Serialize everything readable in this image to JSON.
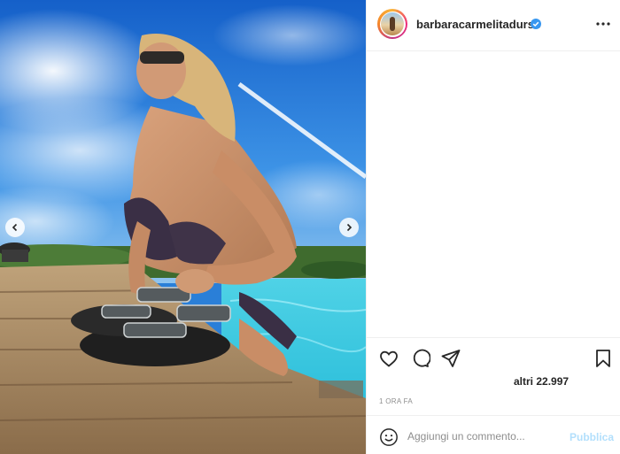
{
  "post": {
    "username": "barbaracarmelitadurso",
    "verified": true,
    "likes_text": "altri 22.997",
    "timestamp": "1 ORA FA"
  },
  "media": {
    "description_icon": "photo",
    "has_prev": true,
    "has_next": true
  },
  "icons": {
    "more": "more-horizontal-icon",
    "like": "heart-icon",
    "comment": "comment-icon",
    "share": "paper-plane-icon",
    "save": "bookmark-icon",
    "emoji": "emoji-icon",
    "verified": "verified-badge-icon"
  },
  "comment_box": {
    "placeholder": "Aggiungi un commento...",
    "value": "",
    "submit_label": "Pubblica"
  },
  "colors": {
    "text": "#262626",
    "muted": "#8e8e8e",
    "verified_blue": "#3897f0",
    "publish_disabled": "#b2dffc",
    "border": "#efefef"
  }
}
